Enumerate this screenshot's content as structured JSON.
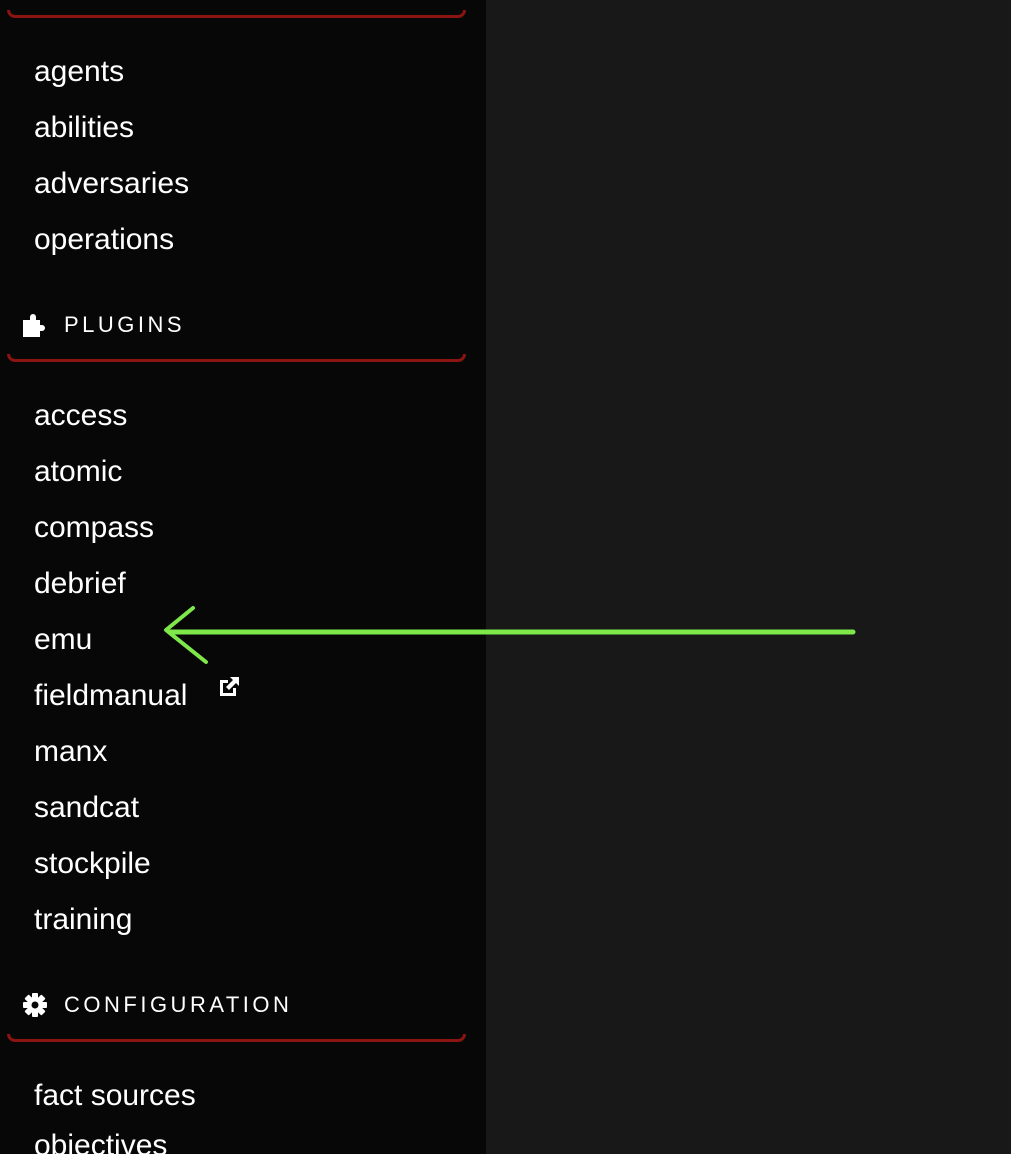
{
  "sidebar": {
    "campaigns": {
      "items": [
        {
          "label": "agents"
        },
        {
          "label": "abilities"
        },
        {
          "label": "adversaries"
        },
        {
          "label": "operations"
        }
      ]
    },
    "plugins": {
      "header": "PLUGINS",
      "icon": "puzzle-icon",
      "items": [
        {
          "label": "access"
        },
        {
          "label": "atomic"
        },
        {
          "label": "compass"
        },
        {
          "label": "debrief"
        },
        {
          "label": "emu"
        },
        {
          "label": "fieldmanual",
          "icon": "external-link-icon"
        },
        {
          "label": "manx"
        },
        {
          "label": "sandcat"
        },
        {
          "label": "stockpile"
        },
        {
          "label": "training"
        }
      ]
    },
    "configuration": {
      "header": "CONFIGURATION",
      "icon": "gear-icon",
      "items": [
        {
          "label": "fact sources"
        },
        {
          "label": "objectives"
        }
      ]
    }
  },
  "colors": {
    "sidebar_bg": "#070707",
    "main_bg": "#181818",
    "divider": "#8a1410",
    "text": "#ffffff",
    "annotation_arrow": "#7ee84a"
  }
}
